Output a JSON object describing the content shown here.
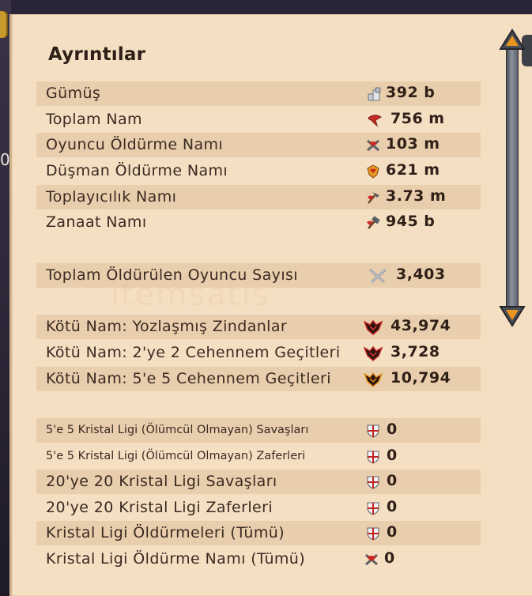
{
  "panel": {
    "title": "Ayrıntılar"
  },
  "watermark": "itemsatis",
  "stats": [
    {
      "label": "Gümüş",
      "value": "392 b",
      "icon": "silver-icon"
    },
    {
      "label": "Toplam Nam",
      "value": "756 m",
      "icon": "fame-icon"
    },
    {
      "label": "Oyuncu Öldürme Namı",
      "value": "103 m",
      "icon": "pvp-fame-icon"
    },
    {
      "label": "Düşman Öldürme Namı",
      "value": "621 m",
      "icon": "pve-fame-icon"
    },
    {
      "label": "Toplayıcılık Namı",
      "value": "3.73 m",
      "icon": "gathering-fame-icon"
    },
    {
      "label": "Zanaat Namı",
      "value": "945 b",
      "icon": "crafting-fame-icon"
    },
    {
      "label": "Toplam Öldürülen Oyuncu Sayısı",
      "value": "3,403",
      "icon": "crossed-swords-icon"
    },
    {
      "label": "Kötü Nam: Yozlaşmış Zindanlar",
      "value": "43,974",
      "icon": "infamy-icon"
    },
    {
      "label": "Kötü Nam: 2'ye 2 Cehennem Geçitleri",
      "value": "3,728",
      "icon": "infamy-icon"
    },
    {
      "label": "Kötü Nam: 5'e 5 Cehennem Geçitleri",
      "value": "10,794",
      "icon": "infamy-icon"
    },
    {
      "label": "5'e 5 Kristal Ligi (Ölümcül Olmayan) Savaşları",
      "value": "0",
      "icon": "crystal-shield-icon"
    },
    {
      "label": "5'e 5 Kristal Ligi (Ölümcül Olmayan) Zaferleri",
      "value": "0",
      "icon": "crystal-shield-icon"
    },
    {
      "label": "20'ye 20 Kristal Ligi Savaşları",
      "value": "0",
      "icon": "crystal-shield-icon"
    },
    {
      "label": "20'ye 20 Kristal Ligi Zaferleri",
      "value": "0",
      "icon": "crystal-shield-icon"
    },
    {
      "label": "Kristal Ligi Öldürmeleri (Tümü)",
      "value": "0",
      "icon": "crystal-shield-icon"
    },
    {
      "label": "Kristal Ligi Öldürme Namı (Tümü)",
      "value": "0",
      "icon": "crystal-fame-icon"
    }
  ],
  "colors": {
    "panel_bg": "#f5dfc3",
    "band_bg": "#e3c6a1",
    "text": "#3a2a22",
    "value": "#2e1f17",
    "infamy_red": "#c0231f",
    "accent_orange": "#e8961e"
  }
}
